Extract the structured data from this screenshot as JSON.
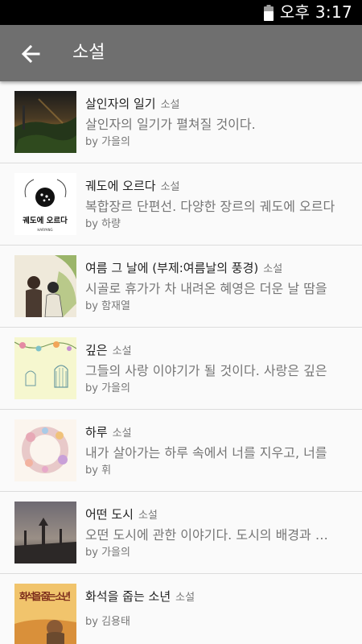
{
  "status_bar": {
    "time": "오후 3:17",
    "battery_icon": "battery-icon"
  },
  "app_bar": {
    "back_icon": "arrow-back-icon",
    "title": "소설"
  },
  "items": [
    {
      "title": "살인자의 일기",
      "category": "소설",
      "description": "살인자의 일기가 펼쳐질 것이다.",
      "author": "by 가을의"
    },
    {
      "title": "궤도에 오르다",
      "category": "소설",
      "description": "복합장르 단편선. 다양한 장르의 궤도에 오르다",
      "author": "by 하량",
      "cover_text": "궤도에 오르다",
      "cover_subtext": "HARYANG"
    },
    {
      "title": "여름 그 날에 (부제:여름날의 풍경)",
      "category": "소설",
      "description": "시골로 휴가가 차 내려온 혜영은 더운 날 땀을",
      "author": "by 함재열"
    },
    {
      "title": "깊은",
      "category": "소설",
      "description": "그들의 사랑 이야기가 될 것이다. 사랑은 깊은",
      "author": "by 가을의"
    },
    {
      "title": "하루",
      "category": "소설",
      "description": "내가 살아가는 하루 속에서 너를 지우고, 너를",
      "author": "by 휘"
    },
    {
      "title": "어떤 도시",
      "category": "소설",
      "description": "오떤 도시에 관한 이야기다. 도시의 배경과 사람",
      "author": "by 가을의"
    },
    {
      "title": "화석을 줍는 소년",
      "category": "소설",
      "description": "",
      "author": "by 김용태",
      "cover_text": "화석을 줍는 소년"
    }
  ]
}
